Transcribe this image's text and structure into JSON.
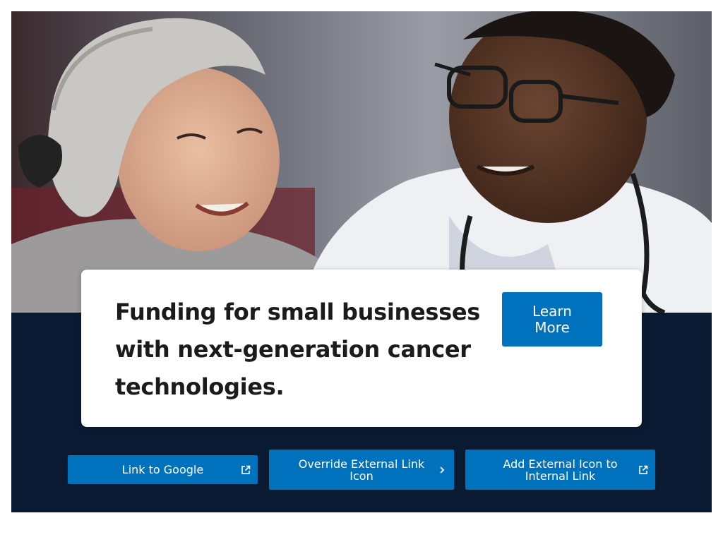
{
  "hero": {
    "image_description_icon": "photo-doctor-and-patient"
  },
  "card": {
    "headline": "Funding for small businesses with next-generation cancer technologies.",
    "cta_label": "Learn More"
  },
  "links": [
    {
      "label": "Link to Google",
      "icon": "external-link-icon"
    },
    {
      "label": "Override External Link Icon",
      "icon": "chevron-right-icon"
    },
    {
      "label": "Add External Icon to Internal Link",
      "icon": "external-link-icon"
    }
  ],
  "colors": {
    "primary_button": "#0071bc",
    "dark_background": "#0b1a33",
    "card_background": "#ffffff",
    "headline_text": "#1b1b1b"
  }
}
